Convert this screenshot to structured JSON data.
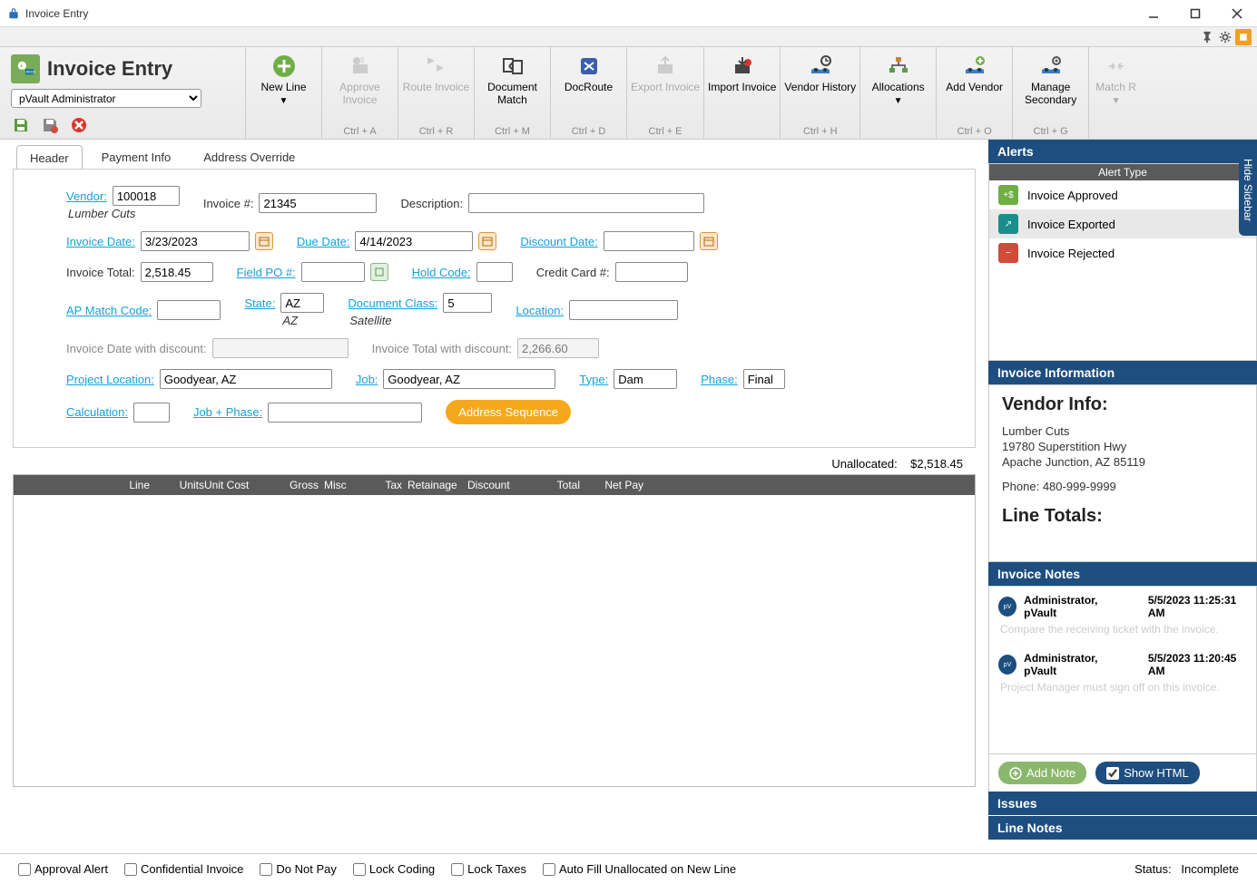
{
  "window": {
    "title": "Invoice Entry"
  },
  "app": {
    "title": "Invoice Entry",
    "user": "pVault Administrator"
  },
  "ribbon": {
    "new_line": "New Line",
    "approve": "Approve\nInvoice",
    "approve_sc": "Ctrl + A",
    "route": "Route Invoice",
    "route_sc": "Ctrl + R",
    "docmatch": "Document\nMatch",
    "docmatch_sc": "Ctrl + M",
    "docroute": "DocRoute",
    "docroute_sc": "Ctrl + D",
    "export": "Export Invoice",
    "export_sc": "Ctrl + E",
    "import": "Import Invoice",
    "vhistory": "Vendor History",
    "vhistory_sc": "Ctrl + H",
    "alloc": "Allocations",
    "addvendor": "Add Vendor",
    "addvendor_sc": "Ctrl + O",
    "manage2": "Manage\nSecondary",
    "manage2_sc": "Ctrl + G",
    "matchrc": "Match R"
  },
  "tabs": {
    "header": "Header",
    "payment": "Payment Info",
    "address": "Address Override"
  },
  "form": {
    "vendor_lbl": "Vendor:",
    "vendor": "100018",
    "vendor_name": "Lumber Cuts",
    "invoice_no_lbl": "Invoice #:",
    "invoice_no": "21345",
    "description_lbl": "Description:",
    "description": "",
    "invoice_date_lbl": "Invoice Date:",
    "invoice_date": "3/23/2023",
    "due_date_lbl": "Due Date:",
    "due_date": "4/14/2023",
    "discount_date_lbl": "Discount Date:",
    "discount_date": "",
    "invoice_total_lbl": "Invoice Total:",
    "invoice_total": "2,518.45",
    "field_po_lbl": "Field PO #:",
    "field_po": "",
    "hold_code_lbl": "Hold Code:",
    "hold_code": "",
    "cc_lbl": "Credit Card #:",
    "cc": "",
    "ap_match_lbl": "AP Match Code:",
    "ap_match": "",
    "state_lbl": "State:",
    "state": "AZ",
    "state_name": "AZ",
    "doc_class_lbl": "Document Class:",
    "doc_class": "5",
    "doc_class_name": "Satellite",
    "location_lbl": "Location:",
    "location": "",
    "inv_date_disc_lbl": "Invoice Date with discount:",
    "inv_date_disc": "",
    "inv_total_disc_lbl": "Invoice Total with discount:",
    "inv_total_disc": "2,266.60",
    "proj_loc_lbl": "Project Location:",
    "proj_loc": "Goodyear, AZ",
    "job_lbl": "Job:",
    "job": "Goodyear, AZ",
    "type_lbl": "Type:",
    "type": "Dam",
    "phase_lbl": "Phase:",
    "phase": "Final",
    "calc_lbl": "Calculation:",
    "calc": "",
    "job_phase_lbl": "Job + Phase:",
    "job_phase": "",
    "addr_seq_btn": "Address Sequence"
  },
  "unallocated": {
    "label": "Unallocated:",
    "value": "$2,518.45"
  },
  "grid": {
    "cols": [
      "Line",
      "Units",
      "Unit Cost",
      "Gross",
      "Misc",
      "Tax",
      "Retainage",
      "Discount",
      "Total",
      "Net Pay"
    ]
  },
  "bottom": {
    "approval_alert": "Approval Alert",
    "confidential": "Confidential Invoice",
    "do_not_pay": "Do Not Pay",
    "lock_coding": "Lock Coding",
    "lock_taxes": "Lock Taxes",
    "autofill": "Auto Fill Unallocated on New Line",
    "status_lbl": "Status:",
    "status": "Incomplete"
  },
  "sidebar": {
    "alerts_title": "Alerts",
    "alert_type_head": "Alert Type",
    "alerts": [
      {
        "label": "Invoice Approved"
      },
      {
        "label": "Invoice Exported"
      },
      {
        "label": "Invoice Rejected"
      }
    ],
    "info_title": "Invoice Information",
    "vendor_info_h": "Vendor Info:",
    "vendor_name": "Lumber Cuts",
    "vendor_addr1": "19780 Superstition Hwy",
    "vendor_addr2": "Apache Junction, AZ 85119",
    "vendor_phone": "Phone: 480-999-9999",
    "line_totals_h": "Line Totals:",
    "notes_title": "Invoice Notes",
    "notes": [
      {
        "author": "Administrator, pVault",
        "ts": "5/5/2023 11:25:31 AM",
        "text": "Compare the receiving ticket with the invoice."
      },
      {
        "author": "Administrator, pVault",
        "ts": "5/5/2023 11:20:45 AM",
        "text": "Project Manager must sign off on this invoice."
      }
    ],
    "add_note_btn": "Add Note",
    "show_html_btn": "Show HTML",
    "issues_title": "Issues",
    "line_notes_title": "Line Notes",
    "hide_sidebar": "Hide Sidebar"
  }
}
